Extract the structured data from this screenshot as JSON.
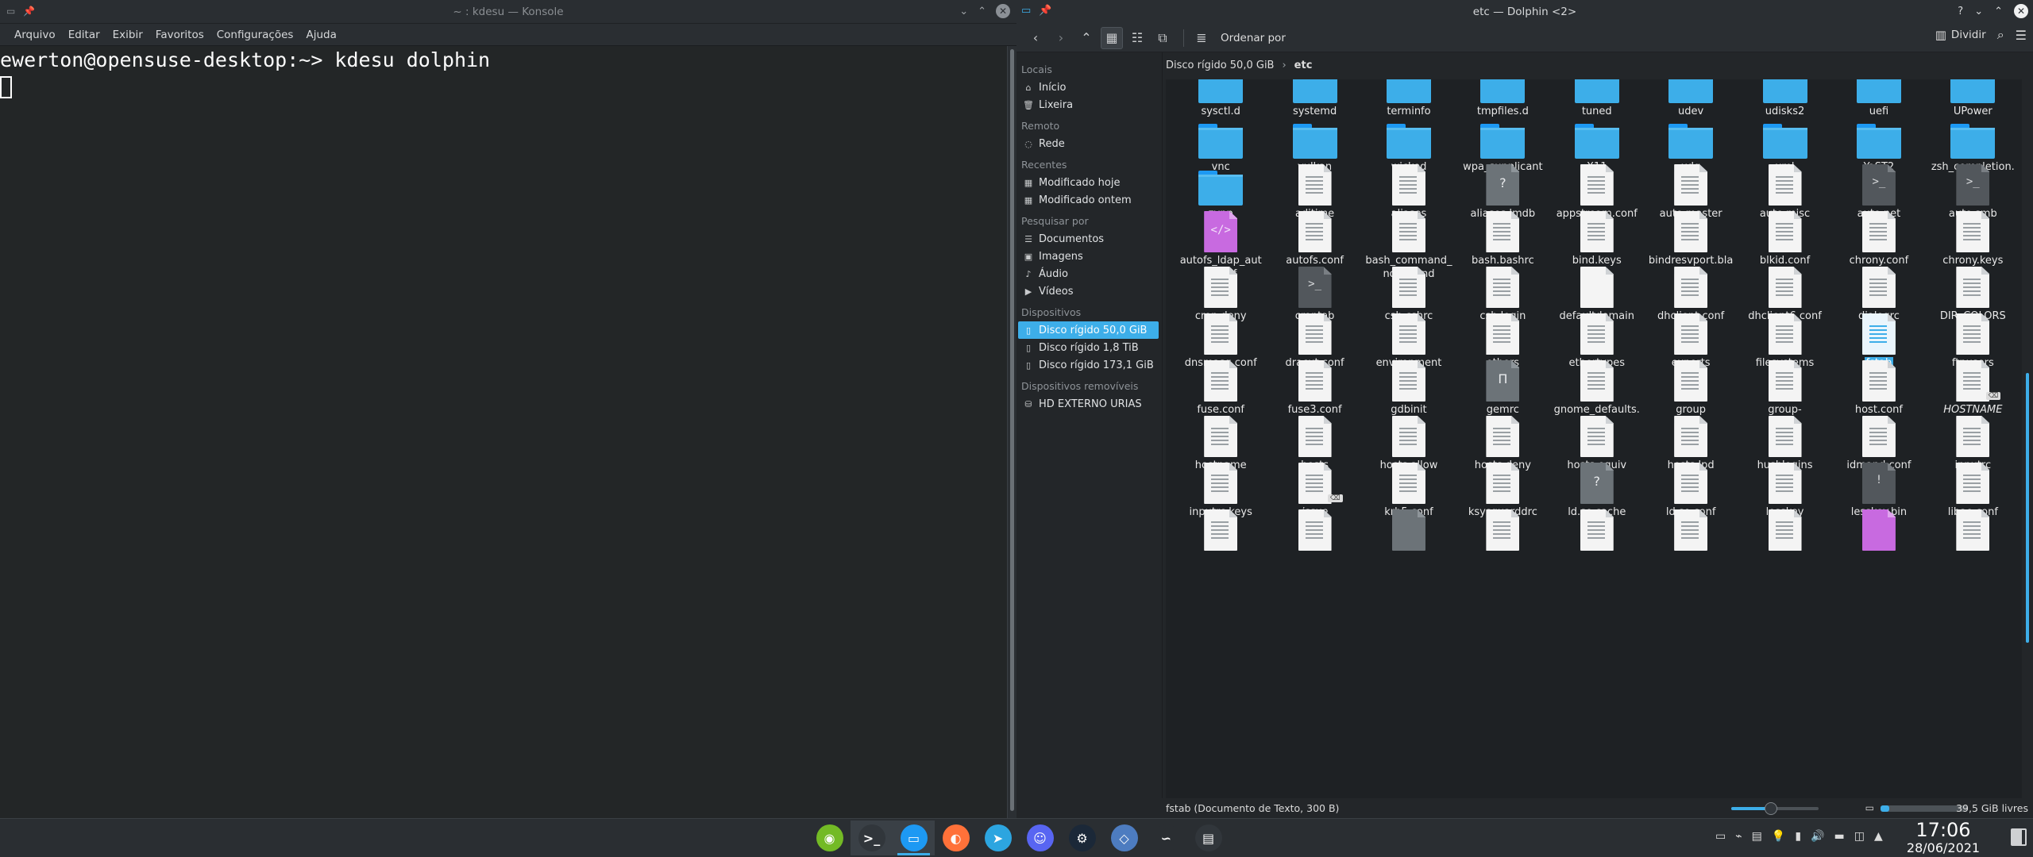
{
  "konsole": {
    "title": "~ : kdesu — Konsole",
    "menu": [
      "Arquivo",
      "Editar",
      "Exibir",
      "Favoritos",
      "Configurações",
      "Ajuda"
    ],
    "terminal_line": "ewerton@opensuse-desktop:~> kdesu dolphin"
  },
  "dolphin": {
    "title": "etc — Dolphin <2>",
    "toolbar": {
      "sort_label": "Ordenar por",
      "split_label": "Dividir"
    },
    "places": [
      {
        "section": "Locais",
        "items": [
          {
            "label": "Início",
            "icon": "home-icon"
          },
          {
            "label": "Lixeira",
            "icon": "trash-icon"
          }
        ]
      },
      {
        "section": "Remoto",
        "items": [
          {
            "label": "Rede",
            "icon": "network-icon"
          }
        ]
      },
      {
        "section": "Recentes",
        "items": [
          {
            "label": "Modificado hoje",
            "icon": "calendar-icon"
          },
          {
            "label": "Modificado ontem",
            "icon": "calendar-icon"
          }
        ]
      },
      {
        "section": "Pesquisar por",
        "items": [
          {
            "label": "Documentos",
            "icon": "documents-icon"
          },
          {
            "label": "Imagens",
            "icon": "image-icon"
          },
          {
            "label": "Áudio",
            "icon": "music-icon"
          },
          {
            "label": "Vídeos",
            "icon": "video-icon"
          }
        ]
      },
      {
        "section": "Dispositivos",
        "items": [
          {
            "label": "Disco rígido 50,0 GiB",
            "icon": "harddisk-icon",
            "selected": true
          },
          {
            "label": "Disco rígido 1,8 TiB",
            "icon": "harddisk-icon"
          },
          {
            "label": "Disco rígido 173,1 GiB",
            "icon": "harddisk-icon"
          }
        ]
      },
      {
        "section": "Dispositivos removíveis",
        "items": [
          {
            "label": "HD EXTERNO URIAS",
            "icon": "usb-drive-icon"
          }
        ]
      }
    ],
    "breadcrumb": {
      "parent": "Disco rígido 50,0 GiB",
      "current": "etc"
    },
    "files": [
      [
        {
          "n": "sysctl.d",
          "t": "folder"
        },
        {
          "n": "systemd",
          "t": "folder"
        },
        {
          "n": "terminfo",
          "t": "folder"
        },
        {
          "n": "tmpfiles.d",
          "t": "folder"
        },
        {
          "n": "tuned",
          "t": "folder"
        },
        {
          "n": "udev",
          "t": "folder"
        },
        {
          "n": "udisks2",
          "t": "folder"
        },
        {
          "n": "uefi",
          "t": "folder"
        },
        {
          "n": "UPower",
          "t": "folder"
        }
      ],
      [
        {
          "n": "vnc",
          "t": "folder"
        },
        {
          "n": "vulkan",
          "t": "folder"
        },
        {
          "n": "wicked",
          "t": "folder"
        },
        {
          "n": "wpa_supplicant",
          "t": "folder"
        },
        {
          "n": "X11",
          "t": "folder"
        },
        {
          "n": "xdg",
          "t": "folder"
        },
        {
          "n": "xml",
          "t": "folder"
        },
        {
          "n": "YaST2",
          "t": "folder"
        },
        {
          "n": "zsh_completion.d",
          "t": "folder"
        }
      ],
      [
        {
          "n": "zypp",
          "t": "folder"
        },
        {
          "n": "adjtime",
          "t": "doc"
        },
        {
          "n": "aliases",
          "t": "doc"
        },
        {
          "n": "aliases.lmdb",
          "t": "gray",
          "g": "?"
        },
        {
          "n": "appstream.conf",
          "t": "doc"
        },
        {
          "n": "auto.master",
          "t": "doc"
        },
        {
          "n": "auto.misc",
          "t": "doc"
        },
        {
          "n": "auto.net",
          "t": "dark",
          "g": ">_"
        },
        {
          "n": "auto.smb",
          "t": "dark",
          "g": ">_"
        }
      ],
      [
        {
          "n": "autofs_ldap_auth.conf",
          "t": "purple",
          "g": "</>"
        },
        {
          "n": "autofs.conf",
          "t": "doc"
        },
        {
          "n": "bash_command_not_found",
          "t": "doc"
        },
        {
          "n": "bash.bashrc",
          "t": "doc"
        },
        {
          "n": "bind.keys",
          "t": "doc"
        },
        {
          "n": "bindresvport.blacklist",
          "t": "doc"
        },
        {
          "n": "blkid.conf",
          "t": "doc"
        },
        {
          "n": "chrony.conf",
          "t": "doc"
        },
        {
          "n": "chrony.keys",
          "t": "doc"
        }
      ],
      [
        {
          "n": "cron.deny",
          "t": "doc"
        },
        {
          "n": "crontab",
          "t": "dark",
          "g": ">_"
        },
        {
          "n": "csh.cshrc",
          "t": "doc"
        },
        {
          "n": "csh.login",
          "t": "doc"
        },
        {
          "n": "defaultdomain",
          "t": "blank"
        },
        {
          "n": "dhclient.conf",
          "t": "doc"
        },
        {
          "n": "dhclient6.conf",
          "t": "doc"
        },
        {
          "n": "dialogrc",
          "t": "doc"
        },
        {
          "n": "DIR_COLORS",
          "t": "doc"
        }
      ],
      [
        {
          "n": "dnsmasq.conf",
          "t": "doc"
        },
        {
          "n": "dracut.conf",
          "t": "doc"
        },
        {
          "n": "environment",
          "t": "doc"
        },
        {
          "n": "ethers",
          "t": "doc"
        },
        {
          "n": "ethertypes",
          "t": "doc"
        },
        {
          "n": "exports",
          "t": "doc"
        },
        {
          "n": "filesystems",
          "t": "doc"
        },
        {
          "n": "fstab",
          "t": "selected",
          "sel": true
        },
        {
          "n": "ftpusers",
          "t": "doc"
        }
      ],
      [
        {
          "n": "fuse.conf",
          "t": "doc"
        },
        {
          "n": "fuse3.conf",
          "t": "doc"
        },
        {
          "n": "gdbinit",
          "t": "doc"
        },
        {
          "n": "gemrc",
          "t": "gray",
          "g": "Π"
        },
        {
          "n": "gnome_defaults.conf",
          "t": "doc"
        },
        {
          "n": "group",
          "t": "doc"
        },
        {
          "n": "group-",
          "t": "doc"
        },
        {
          "n": "host.conf",
          "t": "doc"
        },
        {
          "n": "HOSTNAME",
          "t": "doc",
          "italic": true,
          "badge": "⌫"
        }
      ],
      [
        {
          "n": "hostname",
          "t": "doc"
        },
        {
          "n": "hosts",
          "t": "doc"
        },
        {
          "n": "hosts.allow",
          "t": "doc"
        },
        {
          "n": "hosts.deny",
          "t": "doc"
        },
        {
          "n": "hosts.equiv",
          "t": "doc"
        },
        {
          "n": "hosts.lpd",
          "t": "doc"
        },
        {
          "n": "hushlogins",
          "t": "doc"
        },
        {
          "n": "idmapd.conf",
          "t": "doc"
        },
        {
          "n": "inputrc",
          "t": "doc"
        }
      ],
      [
        {
          "n": "inputrc.keys",
          "t": "doc"
        },
        {
          "n": "issue",
          "t": "doc",
          "italic": true,
          "badge": "⌫"
        },
        {
          "n": "krb5.conf",
          "t": "doc"
        },
        {
          "n": "ksysguarddrc",
          "t": "doc"
        },
        {
          "n": "ld.so.cache",
          "t": "gray",
          "g": "?"
        },
        {
          "n": "ld.so.conf",
          "t": "doc"
        },
        {
          "n": "lesskey",
          "t": "doc"
        },
        {
          "n": "lesskey.bin",
          "t": "dark",
          "g": "!"
        },
        {
          "n": "libao.conf",
          "t": "doc"
        }
      ],
      [
        {
          "n": "",
          "t": "doc"
        },
        {
          "n": "",
          "t": "doc"
        },
        {
          "n": "",
          "t": "gray",
          "g": ""
        },
        {
          "n": "",
          "t": "doc"
        },
        {
          "n": "",
          "t": "doc"
        },
        {
          "n": "",
          "t": "doc"
        },
        {
          "n": "",
          "t": "doc"
        },
        {
          "n": "",
          "t": "purple",
          "g": ""
        },
        {
          "n": "",
          "t": "doc"
        }
      ]
    ],
    "status_text": "fstab (Documento de Texto, 300 B)",
    "zoom_level": 0.45,
    "disk_used_fraction": 0.1,
    "free_space": "39,5 GiB livres"
  },
  "panel": {
    "tasks": [
      {
        "name": "opensuse-launcher",
        "glyph": "◉",
        "bg": "#73ba25"
      },
      {
        "name": "konsole-task",
        "glyph": ">_",
        "bg": "#31363b",
        "active": true
      },
      {
        "name": "dolphin-task",
        "glyph": "▭",
        "bg": "#1d99f3",
        "active": true
      },
      {
        "name": "firefox-task",
        "glyph": "◐",
        "bg": "#ff7139"
      },
      {
        "name": "telegram-task",
        "glyph": "➤",
        "bg": "#2ca5e0"
      },
      {
        "name": "discord-task",
        "glyph": "☺",
        "bg": "#5865f2"
      },
      {
        "name": "steam-task",
        "glyph": "⚙",
        "bg": "#1b2838"
      },
      {
        "name": "kodi-task",
        "glyph": "◇",
        "bg": "#4d7cc0"
      },
      {
        "name": "dolphin-emu-task",
        "glyph": "∽",
        "bg": "#2a2e32"
      },
      {
        "name": "monitor-task",
        "glyph": "▤",
        "bg": "#31363b"
      }
    ],
    "tray_icons": [
      "display-icon",
      "usb-icon",
      "clipboard-icon",
      "bulb-icon",
      "usb-device-icon",
      "volume-icon",
      "battery-icon",
      "network-icon",
      "chevron-up-icon"
    ],
    "time": "17:06",
    "date": "28/06/2021"
  }
}
